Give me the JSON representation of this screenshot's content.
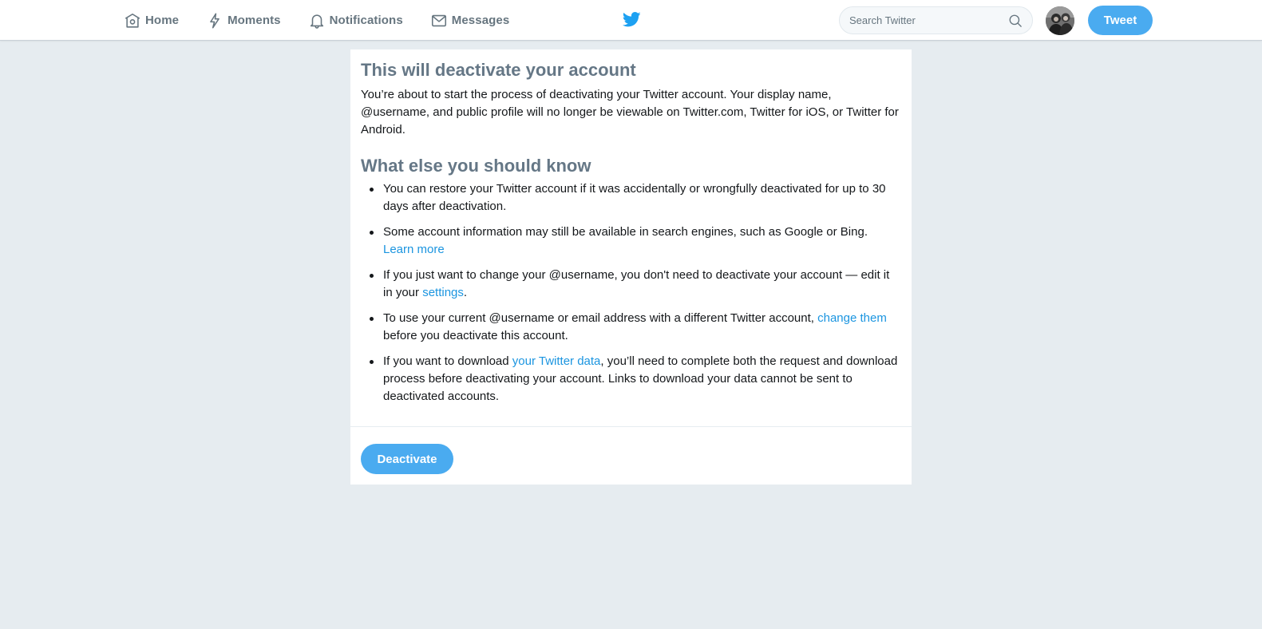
{
  "nav": {
    "items": [
      {
        "label": "Home",
        "icon": "home-icon"
      },
      {
        "label": "Moments",
        "icon": "lightning-icon"
      },
      {
        "label": "Notifications",
        "icon": "bell-icon"
      },
      {
        "label": "Messages",
        "icon": "envelope-icon"
      }
    ],
    "logo": "twitter-bird-icon",
    "search_placeholder": "Search Twitter",
    "tweet_label": "Tweet"
  },
  "colors": {
    "accent": "#4aabf0",
    "link": "#1b95e0",
    "heading": "#657786",
    "background": "#e6ecf0"
  },
  "card": {
    "title": "This will deactivate your account",
    "intro": "You’re about to start the process of deactivating your Twitter account. Your display name, @username, and public profile will no longer be viewable on Twitter.com, Twitter for iOS, or Twitter for Android.",
    "subtitle": "What else you should know",
    "bullets": [
      {
        "text_before": "You can restore your Twitter account if it was accidentally or wrongfully deactivated for up to 30 days after deactivation.",
        "link": "",
        "text_after": ""
      },
      {
        "text_before": "Some account information may still be available in search engines, such as Google or Bing. ",
        "link": "Learn more",
        "text_after": ""
      },
      {
        "text_before": "If you just want to change your @username, you don't need to deactivate your account — edit it in your ",
        "link": "settings",
        "text_after": "."
      },
      {
        "text_before": "To use your current @username or email address with a different Twitter account, ",
        "link": "change them",
        "text_after": " before you deactivate this account."
      },
      {
        "text_before": "If you want to download ",
        "link": "your Twitter data",
        "text_after": ", you’ll need to complete both the request and download process before deactivating your account. Links to download your data cannot be sent to deactivated accounts."
      }
    ],
    "deactivate_label": "Deactivate"
  }
}
